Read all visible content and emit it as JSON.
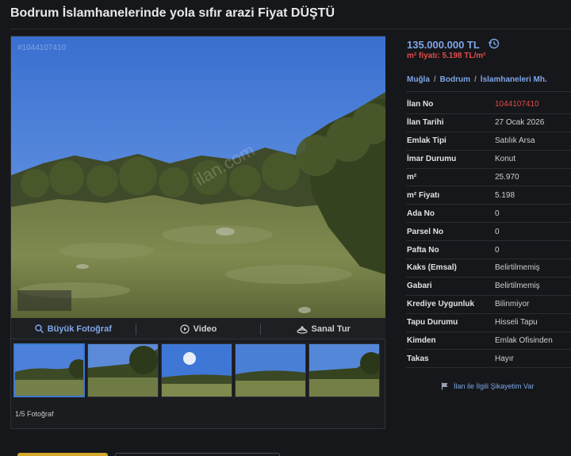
{
  "listing": {
    "title": "Bodrum İslamhanelerinde yola sıfır arazi Fiyat DÜŞTÜ",
    "photo_id_watermark": "#1044107410",
    "site_watermark": "ilan.com"
  },
  "media": {
    "buttons": [
      {
        "label": "Büyük Fotoğraf",
        "icon": "magnifier-icon"
      },
      {
        "label": "Video",
        "icon": "play-circle-icon"
      },
      {
        "label": "Sanal Tur",
        "icon": "360-tour-icon"
      }
    ],
    "photo_counter": "1/5 Fotoğraf"
  },
  "price": {
    "value": "135.000.000 TL",
    "unit_price": "m² fiyatı: 5.198 TL/m²",
    "history_icon": "price-history-icon"
  },
  "breadcrumb": [
    "Muğla",
    "Bodrum",
    "İslamhaneleri Mh."
  ],
  "details": [
    {
      "key": "İlan No",
      "value": "1044107410",
      "highlight": true
    },
    {
      "key": "İlan Tarihi",
      "value": "27 Ocak 2026"
    },
    {
      "key": "Emlak Tipi",
      "value": "Satılık Arsa"
    },
    {
      "key": "İmar Durumu",
      "value": "Konut"
    },
    {
      "key": "m²",
      "value": "25.970"
    },
    {
      "key": "m² Fiyatı",
      "value": "5.198"
    },
    {
      "key": "Ada No",
      "value": "0"
    },
    {
      "key": "Parsel No",
      "value": "0"
    },
    {
      "key": "Pafta No",
      "value": "0"
    },
    {
      "key": "Kaks (Emsal)",
      "value": "Belirtilmemiş"
    },
    {
      "key": "Gabari",
      "value": "Belirtilmemiş"
    },
    {
      "key": "Krediye Uygunluk",
      "value": "Bilinmiyor"
    },
    {
      "key": "Tapu Durumu",
      "value": "Hisseli Tapu"
    },
    {
      "key": "Kimden",
      "value": "Emlak Ofisinden"
    },
    {
      "key": "Takas",
      "value": "Hayır"
    }
  ],
  "complaint": {
    "label": "İlan ile İlgili Şikayetim Var",
    "icon": "flag-icon"
  },
  "colors": {
    "accent": "#7fa6e8",
    "alert": "#e24b4b",
    "background": "#15171a",
    "tab_active": "#d4a62a"
  }
}
